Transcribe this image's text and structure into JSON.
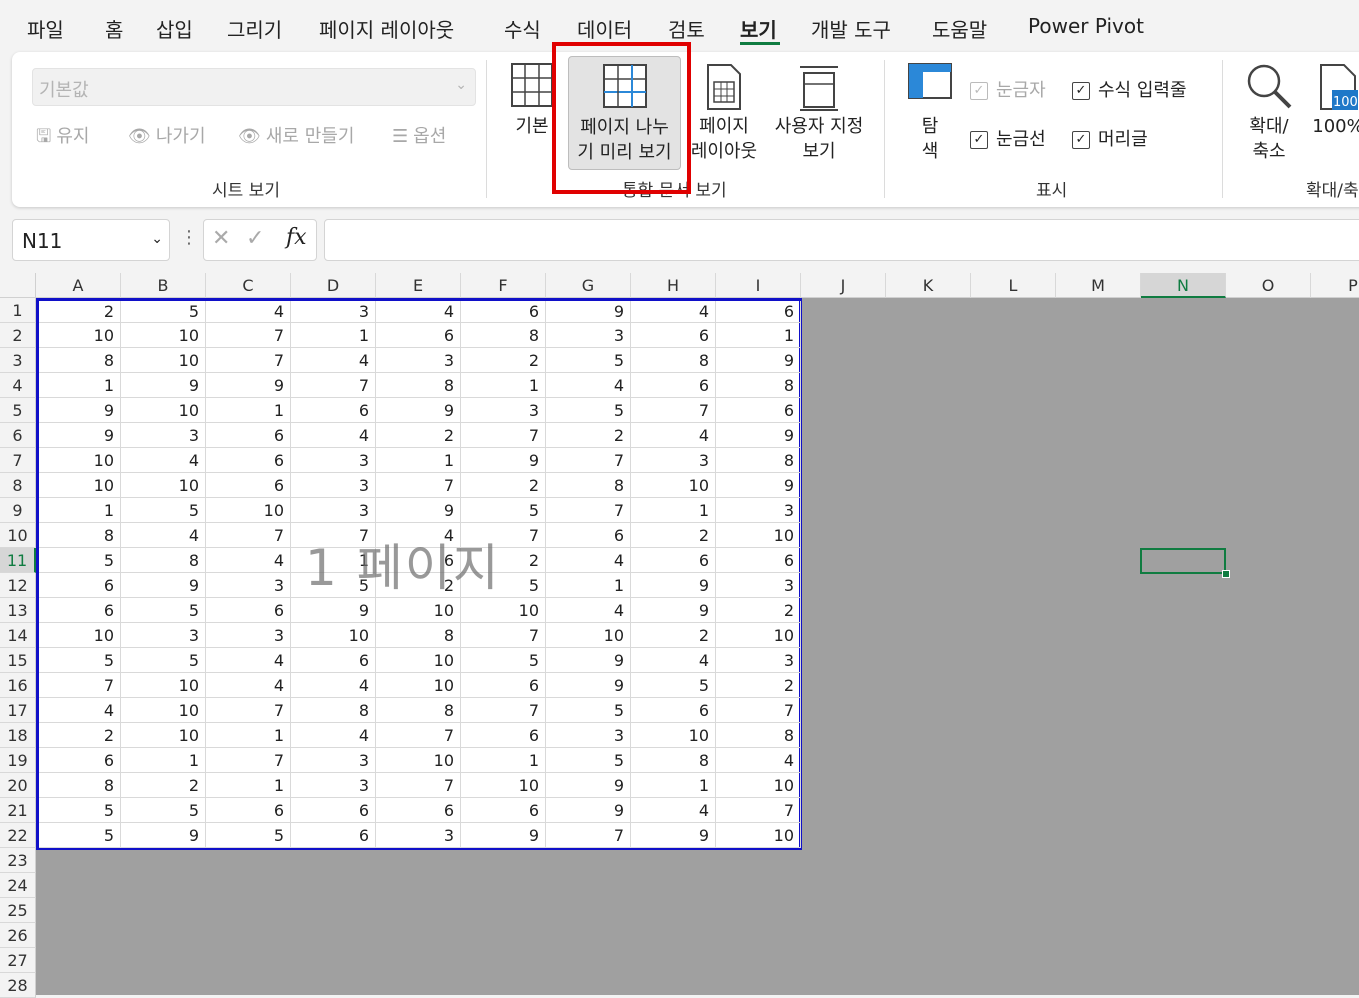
{
  "tabs": [
    "파일",
    "홈",
    "삽입",
    "그리기",
    "페이지 레이아웃",
    "수식",
    "데이터",
    "검토",
    "보기",
    "개발 도구",
    "도움말",
    "Power Pivot"
  ],
  "active_tab": "보기",
  "sheet_view": {
    "combo_value": "기본값",
    "keep": "유지",
    "exit": "나가기",
    "new": "새로 만들기",
    "options": "옵션",
    "group_label": "시트 보기"
  },
  "workbook_views": {
    "normal": "기본",
    "page_break_line1": "페이지 나누",
    "page_break_line2": "기 미리 보기",
    "page_layout_line1": "페이지",
    "page_layout_line2": "레이아웃",
    "custom_line1": "사용자 지정",
    "custom_line2": "보기",
    "group_label": "통합 문서 보기"
  },
  "show": {
    "nav_line1": "탐",
    "nav_line2": "색",
    "ruler": "눈금자",
    "formula_bar": "수식 입력줄",
    "gridlines": "눈금선",
    "headings": "머리글",
    "group_label": "표시"
  },
  "zoom": {
    "zoom_line1": "확대/",
    "zoom_line2": "축소",
    "hundred": "100%",
    "icon_text": "100",
    "group_label": "확대/축"
  },
  "name_box": "N11",
  "fx_label": "fx",
  "columns": [
    "A",
    "B",
    "C",
    "D",
    "E",
    "F",
    "G",
    "H",
    "I",
    "J",
    "K",
    "L",
    "M",
    "N",
    "O",
    "P"
  ],
  "selected_column": "N",
  "selected_row": 11,
  "rows": [
    1,
    2,
    3,
    4,
    5,
    6,
    7,
    8,
    9,
    10,
    11,
    12,
    13,
    14,
    15,
    16,
    17,
    18,
    19,
    20,
    21,
    22,
    23,
    24,
    25,
    26,
    27,
    28
  ],
  "cells": [
    [
      2,
      5,
      4,
      3,
      4,
      6,
      9,
      4,
      6
    ],
    [
      10,
      10,
      7,
      1,
      6,
      8,
      3,
      6,
      1
    ],
    [
      8,
      10,
      7,
      4,
      3,
      2,
      5,
      8,
      9
    ],
    [
      1,
      9,
      9,
      7,
      8,
      1,
      4,
      6,
      8
    ],
    [
      9,
      10,
      1,
      6,
      9,
      3,
      5,
      7,
      6
    ],
    [
      9,
      3,
      6,
      4,
      2,
      7,
      2,
      4,
      9
    ],
    [
      10,
      4,
      6,
      3,
      1,
      9,
      7,
      3,
      8
    ],
    [
      10,
      10,
      6,
      3,
      7,
      2,
      8,
      10,
      9
    ],
    [
      1,
      5,
      10,
      3,
      9,
      5,
      7,
      1,
      3
    ],
    [
      8,
      4,
      7,
      7,
      4,
      7,
      6,
      2,
      10
    ],
    [
      5,
      8,
      4,
      1,
      6,
      2,
      4,
      6,
      6
    ],
    [
      6,
      9,
      3,
      5,
      2,
      5,
      1,
      9,
      3
    ],
    [
      6,
      5,
      6,
      9,
      10,
      10,
      4,
      9,
      2
    ],
    [
      10,
      3,
      3,
      10,
      8,
      7,
      10,
      2,
      10
    ],
    [
      5,
      5,
      4,
      6,
      10,
      5,
      9,
      4,
      3
    ],
    [
      7,
      10,
      4,
      4,
      10,
      6,
      9,
      5,
      2
    ],
    [
      4,
      10,
      7,
      8,
      8,
      7,
      5,
      6,
      7
    ],
    [
      2,
      10,
      1,
      4,
      7,
      6,
      3,
      10,
      8
    ],
    [
      6,
      1,
      7,
      3,
      10,
      1,
      5,
      8,
      4
    ],
    [
      8,
      2,
      1,
      3,
      7,
      10,
      9,
      1,
      10
    ],
    [
      5,
      5,
      6,
      6,
      6,
      6,
      9,
      4,
      7
    ],
    [
      5,
      9,
      5,
      6,
      3,
      9,
      7,
      9,
      10
    ]
  ],
  "page_watermark": "1 페이지",
  "colors": {
    "accent": "#107c41",
    "page_border": "#1010c8",
    "highlight": "#e00000",
    "outside_print_area": "#a0a0a0"
  }
}
